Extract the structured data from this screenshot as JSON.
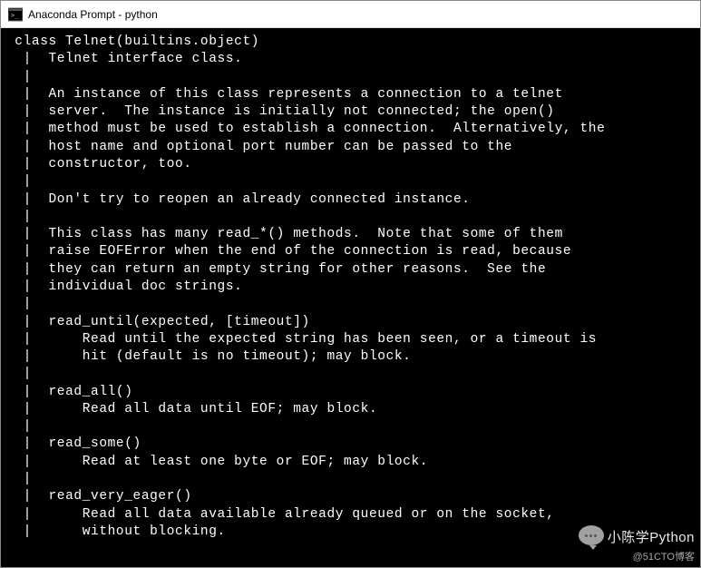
{
  "window": {
    "title": "Anaconda Prompt - python"
  },
  "terminal": {
    "lines": [
      " class Telnet(builtins.object)",
      "  |  Telnet interface class.",
      "  |",
      "  |  An instance of this class represents a connection to a telnet",
      "  |  server.  The instance is initially not connected; the open()",
      "  |  method must be used to establish a connection.  Alternatively, the",
      "  |  host name and optional port number can be passed to the",
      "  |  constructor, too.",
      "  |",
      "  |  Don't try to reopen an already connected instance.",
      "  |",
      "  |  This class has many read_*() methods.  Note that some of them",
      "  |  raise EOFError when the end of the connection is read, because",
      "  |  they can return an empty string for other reasons.  See the",
      "  |  individual doc strings.",
      "  |",
      "  |  read_until(expected, [timeout])",
      "  |      Read until the expected string has been seen, or a timeout is",
      "  |      hit (default is no timeout); may block.",
      "  |",
      "  |  read_all()",
      "  |      Read all data until EOF; may block.",
      "  |",
      "  |  read_some()",
      "  |      Read at least one byte or EOF; may block.",
      "  |",
      "  |  read_very_eager()",
      "  |      Read all data available already queued or on the socket,",
      "  |      without blocking."
    ]
  },
  "watermark": {
    "main": "小陈学Python",
    "sub": "@51CTO博客"
  }
}
